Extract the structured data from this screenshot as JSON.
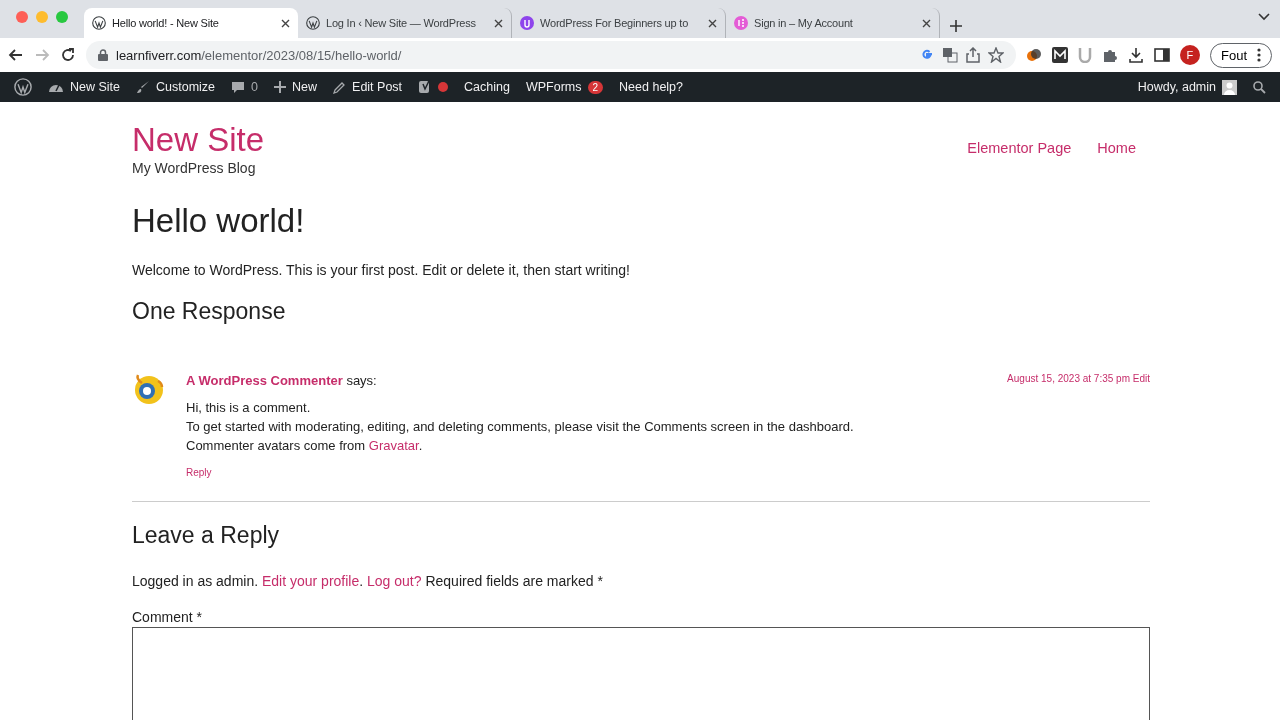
{
  "browser": {
    "tabs": [
      {
        "title": "Hello world! - New Site",
        "kind": "wordpress",
        "selected": true
      },
      {
        "title": "Log In ‹ New Site — WordPress",
        "kind": "wordpress",
        "selected": false
      },
      {
        "title": "WordPress For Beginners up to",
        "kind": "course",
        "selected": false
      },
      {
        "title": "Sign in – My Account",
        "kind": "account",
        "selected": false
      }
    ],
    "url": {
      "host": "learnfiverr.com",
      "path": "/elementor/2023/08/15/hello-world/"
    },
    "profile_initial": "F",
    "profile_button": "Fout"
  },
  "admin_bar": {
    "items": [
      {
        "kind": "dashboard",
        "label": "New Site"
      },
      {
        "kind": "customize",
        "label": "Customize"
      },
      {
        "kind": "comments",
        "label": "0"
      },
      {
        "kind": "new",
        "label": "New"
      },
      {
        "kind": "edit",
        "label": "Edit Post"
      },
      {
        "kind": "seo"
      },
      {
        "kind": "plain",
        "label": "Caching"
      },
      {
        "kind": "badge",
        "label": "WPForms",
        "badge": "2"
      },
      {
        "kind": "plain",
        "label": "Need help?"
      }
    ],
    "howdy": "Howdy, admin"
  },
  "site": {
    "title": "New Site",
    "tagline": "My WordPress Blog",
    "nav": [
      "Elementor Page",
      "Home"
    ]
  },
  "post": {
    "title": "Hello world!",
    "body": "Welcome to WordPress. This is your first post. Edit or delete it, then start writing!"
  },
  "comments": {
    "heading": "One Response",
    "list": [
      {
        "author": "A WordPress Commenter",
        "says": "says:",
        "date": "August 15, 2023 at 7:35 pm",
        "edit": "Edit",
        "lines": [
          "Hi, this is a comment.",
          "To get started with moderating, editing, and deleting comments, please visit the Comments screen in the dashboard."
        ],
        "last_line": {
          "before": "Commenter avatars come from ",
          "link": "Gravatar",
          "after": "."
        },
        "reply": "Reply"
      }
    ]
  },
  "reply_form": {
    "heading": "Leave a Reply",
    "logged_in": {
      "before": "Logged in as admin. ",
      "profile_link": "Edit your profile",
      "between": ". ",
      "logout_link": "Log out?",
      "after": " Required fields are marked *"
    },
    "comment_label": "Comment *"
  }
}
